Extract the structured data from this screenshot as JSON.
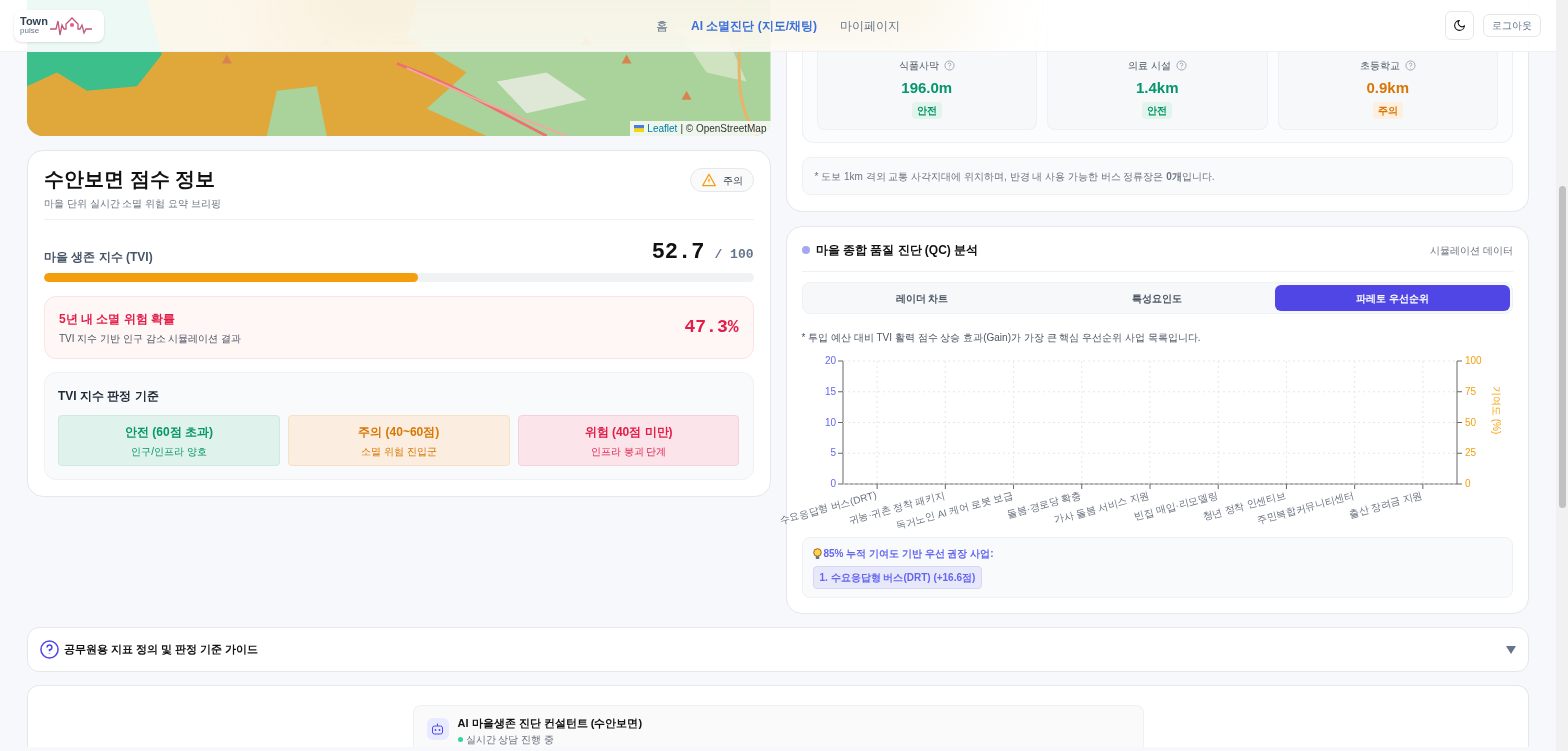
{
  "header": {
    "logo": {
      "word": "Town",
      "sub": "pulse"
    },
    "nav": [
      {
        "label": "홈",
        "selected": false
      },
      {
        "label": "AI 소멸진단 (지도/채팅)",
        "selected": true
      },
      {
        "label": "마이페이지",
        "selected": false
      }
    ],
    "logout": "로그아웃"
  },
  "map": {
    "kind": "picture",
    "attribution_link": "Leaflet",
    "attribution_text": "| © OpenStreetMap"
  },
  "score_card": {
    "title": "수안보면 점수 정보",
    "subtitle": "마을 단위 실시간 소멸 위험 요약 브리핑",
    "badge": "주의",
    "tvi_label": "마을 생존 지수 (TVI)",
    "tvi_value": "52.7",
    "tvi_max": "/ 100",
    "level": 0.527,
    "risk": {
      "title": "5년 내 소멸 위험 확률",
      "desc": "TVI 지수 기반 인구 감소 시뮬레이션 결과",
      "value": "47.3%"
    },
    "criteria_title": "TVI 지수 판정 기준",
    "criteria": [
      {
        "kind": "safe",
        "title": "안전 (60점 초과)",
        "desc": "인구/인프라 양호"
      },
      {
        "kind": "caution",
        "title": "주의 (40~60점)",
        "desc": "소멸 위험 진입군"
      },
      {
        "kind": "danger",
        "title": "위험 (40점 미만)",
        "desc": "인프라 붕괴 단계"
      }
    ]
  },
  "access_card": {
    "metrics": [
      {
        "label": "식품사막",
        "value": "196.0m",
        "status": "안전",
        "kind": "safe"
      },
      {
        "label": "의료 시설",
        "value": "1.4km",
        "status": "안전",
        "kind": "safe"
      },
      {
        "label": "초등학교",
        "value": "0.9km",
        "status": "주의",
        "kind": "caution"
      }
    ],
    "note": "* 도보 1km 격외 교통 사각지대에 위치하며, 반경 내 사용 가능한 버스 정류장은 **0개**입니다."
  },
  "qc_card": {
    "title": "마을 종합 품질 진단 (QC) 분석",
    "source": "시뮬레이션 데이터",
    "tabs": [
      {
        "label": "레이더 차트",
        "selected": false
      },
      {
        "label": "특성요인도",
        "selected": false
      },
      {
        "label": "파레토 우선순위",
        "selected": true
      }
    ],
    "description": "* 투입 예산 대비 TVI 활력 점수 상승 효과(Gain)가 가장 큰 핵심 우선순위 사업 목록입니다.",
    "chart_data": {
      "type": "bar",
      "categories": [
        "수요응답형 버스(DRT)",
        "귀농·귀촌 정착 패키지",
        "독거노인 AI 케어 로봇 보급",
        "돌봄·경로당 확충",
        "가사 돌봄 서비스 지원",
        "빈집 매입·리모델링",
        "청년 정착 인센티브",
        "주민복합커뮤니티센터",
        "출산 장려금 지원"
      ],
      "values": [
        null,
        null,
        null,
        null,
        null,
        null,
        null,
        null,
        null
      ],
      "ylim": [
        0,
        20
      ],
      "yticks": [
        0,
        5,
        10,
        15,
        20
      ],
      "grid": true,
      "y2lim": [
        0,
        100
      ],
      "y2ticks": [
        0,
        25,
        50,
        75,
        100
      ],
      "y2label": "기여도 (%)"
    },
    "recommend_title": "85% 누적 기여도 기반 우선 권장 사업:",
    "recommend_items": [
      "1. 수요응답형 버스(DRT) (+16.6점)"
    ]
  },
  "guide": {
    "title": "공무원용 지표 정의 및 판정 기준 가이드",
    "expanded": false
  },
  "chat": {
    "title": "AI 마을생존 진단 컨설턴트 (수안보면)",
    "status": "실시간 상담 진행 중"
  }
}
